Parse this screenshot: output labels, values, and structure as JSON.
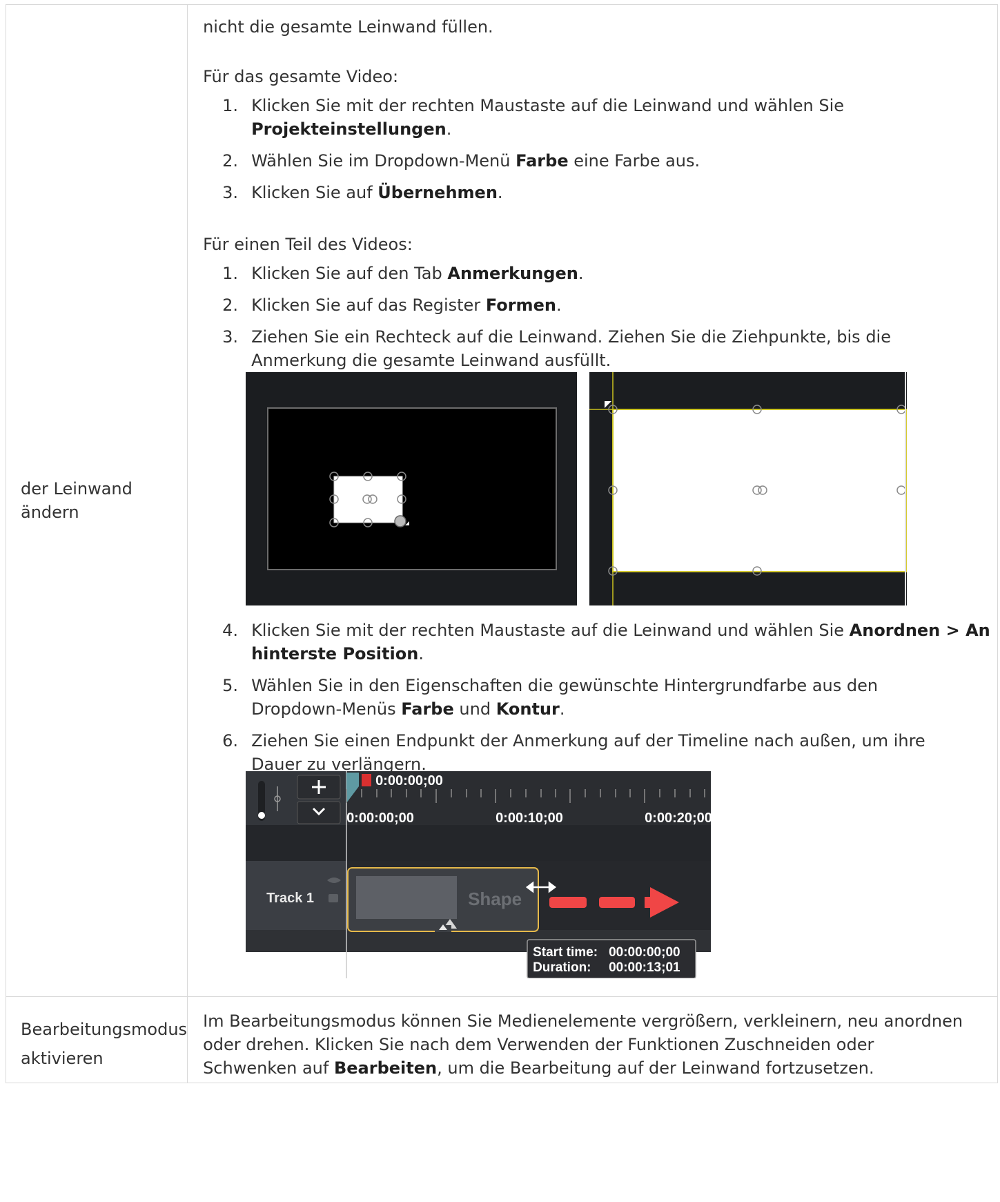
{
  "row1": {
    "left_label_line1": "der Leinwand",
    "left_label_line2": "ändern",
    "intro_fragment": "nicht die gesamte Leinwand füllen.",
    "section_whole": {
      "heading": "Für das gesamte Video:",
      "steps": [
        {
          "num": "1.",
          "pre": "Klicken Sie mit der rechten Maustaste auf die Leinwand und wählen Sie",
          "b1": "Projekteinstellungen",
          "post": "."
        },
        {
          "num": "2.",
          "pre": "Wählen Sie im Dropdown-Menü",
          "b1": "Farbe",
          "post": "eine Farbe aus."
        },
        {
          "num": "3.",
          "pre": "Klicken Sie auf",
          "b1": "Übernehmen",
          "post": "."
        }
      ]
    },
    "section_part": {
      "heading": "Für einen Teil des Videos:",
      "steps": [
        {
          "num": "1.",
          "pre": "Klicken Sie auf den Tab",
          "b1": "Anmerkungen",
          "post": "."
        },
        {
          "num": "2.",
          "pre": "Klicken Sie auf das Register",
          "b1": "Formen",
          "post": "."
        },
        {
          "num": "3.",
          "line1": "Ziehen Sie ein Rechteck auf die Leinwand. Ziehen Sie die Ziehpunkte, bis die",
          "line2": "Anmerkung die gesamte Leinwand ausfüllt."
        },
        {
          "num": "4.",
          "pre": "Klicken Sie mit der rechten Maustaste auf die Leinwand und wählen Sie",
          "b1": "Anordnen > An",
          "b1b": "hinterste Position",
          "post": "."
        },
        {
          "num": "5.",
          "line1": "Wählen Sie in den Eigenschaften die gewünschte Hintergrundfarbe aus den",
          "pre": "Dropdown-Menüs",
          "b1": "Farbe",
          "mid": "und",
          "b2": "Kontur",
          "post": "."
        },
        {
          "num": "6.",
          "line1": "Ziehen Sie einen Endpunkt der Anmerkung auf der Timeline nach außen, um ihre",
          "line2": "Dauer zu verlängern."
        }
      ]
    },
    "timeline": {
      "playhead_time": "0:00:00;00",
      "ruler": [
        "0:00:00;00",
        "0:00:10;00",
        "0:00:20;00"
      ],
      "track_name": "Track 1",
      "clip_label": "Shape",
      "tooltip_start_label": "Start time:",
      "tooltip_start_value": "00:00:00;00",
      "tooltip_duration_label": "Duration:",
      "tooltip_duration_value": "00:00:13;01",
      "arrow_color": "#f04646",
      "clip_border_color": "#e6b94a"
    }
  },
  "row2": {
    "left_label_line1": "Bearbeitungsmodus",
    "left_label_line2": "aktivieren",
    "line1": "Im Bearbeitungsmodus können Sie Medienelemente vergrößern, verkleinern, neu anordnen",
    "line2": "oder drehen. Klicken Sie nach dem Verwenden der Funktionen Zuschneiden oder",
    "line3_pre": "Schwenken auf",
    "line3_b": "Bearbeiten",
    "line3_post": ", um die Bearbeitung auf der Leinwand fortzusetzen."
  }
}
